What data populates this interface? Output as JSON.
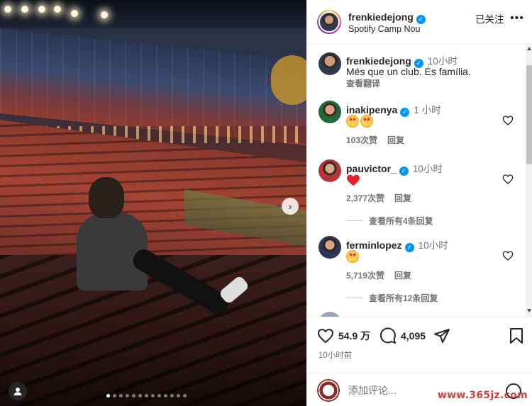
{
  "header": {
    "username": "frenkiedejong",
    "location": "Spotify Camp Nou",
    "follow_label": "已关注",
    "more_label": "•••"
  },
  "caption": {
    "username": "frenkiedejong",
    "time": "10小时",
    "text": "Més que un club. És família.",
    "translate_label": "查看翻译"
  },
  "comments": [
    {
      "username": "inakipenya",
      "time": "1 小时",
      "emojis": [
        "star-struck",
        "star-struck"
      ],
      "likes": "103次赞",
      "reply_label": "回复"
    },
    {
      "username": "pauvictor_",
      "time": "10小时",
      "emojis": [
        "red-heart"
      ],
      "likes": "2,377次赞",
      "reply_label": "回复",
      "view_replies": "查看所有4条回复"
    },
    {
      "username": "ferminlopez",
      "time": "10小时",
      "emojis": [
        "star-struck"
      ],
      "likes": "5,719次赞",
      "reply_label": "回复",
      "view_replies": "查看所有12条回复"
    }
  ],
  "actions": {
    "likes": "54.9 万",
    "comments": "4,095",
    "timestamp": "10小时前"
  },
  "comment_box": {
    "placeholder": "添加评论..."
  },
  "carousel": {
    "total_slides": 13,
    "active_index": 0
  },
  "watermark": "www.365jz.com",
  "colors": {
    "verified": "#0095f6",
    "heart_red": "#ed4956",
    "watermark": "#d3423a"
  }
}
